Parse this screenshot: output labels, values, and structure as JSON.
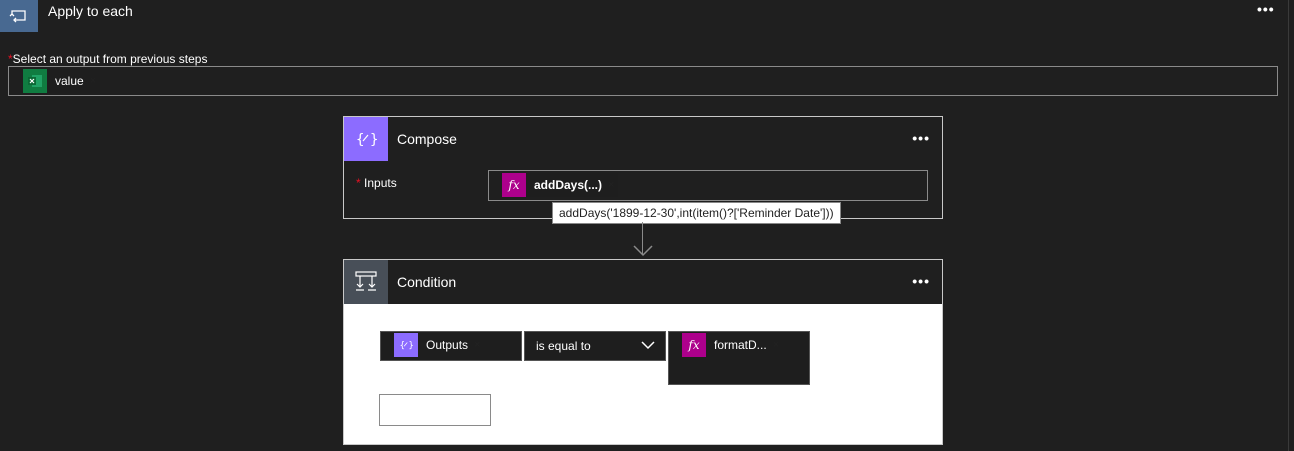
{
  "apply_to_each": {
    "title": "Apply to each",
    "more": "•••"
  },
  "select_output": {
    "required_mark": "*",
    "label": "Select an output from previous steps",
    "token": {
      "label": "value",
      "icon": "excel-icon",
      "remove": "×"
    }
  },
  "compose": {
    "title": "Compose",
    "icon": "compose-icon",
    "more": "•••",
    "inputs_required": "*",
    "inputs_label": "Inputs",
    "token": {
      "label": "addDays(...)",
      "icon": "fx",
      "remove": "×"
    },
    "tooltip": "addDays('1899-12-30',int(item()?['Reminder Date']))"
  },
  "condition": {
    "title": "Condition",
    "icon": "condition-icon",
    "more": "•••",
    "left_token": {
      "label": "Outputs",
      "remove": "×"
    },
    "operator": "is equal to",
    "right_token": {
      "label": "formatD...",
      "icon": "fx",
      "remove": "×"
    }
  },
  "colors": {
    "apply_icon_bg": "#486991",
    "compose_icon_bg": "#8c6cff",
    "condition_icon_bg": "#484f58",
    "fx_bg": "#ad008c",
    "excel_bg": "#107c41",
    "required": "#e81123"
  }
}
